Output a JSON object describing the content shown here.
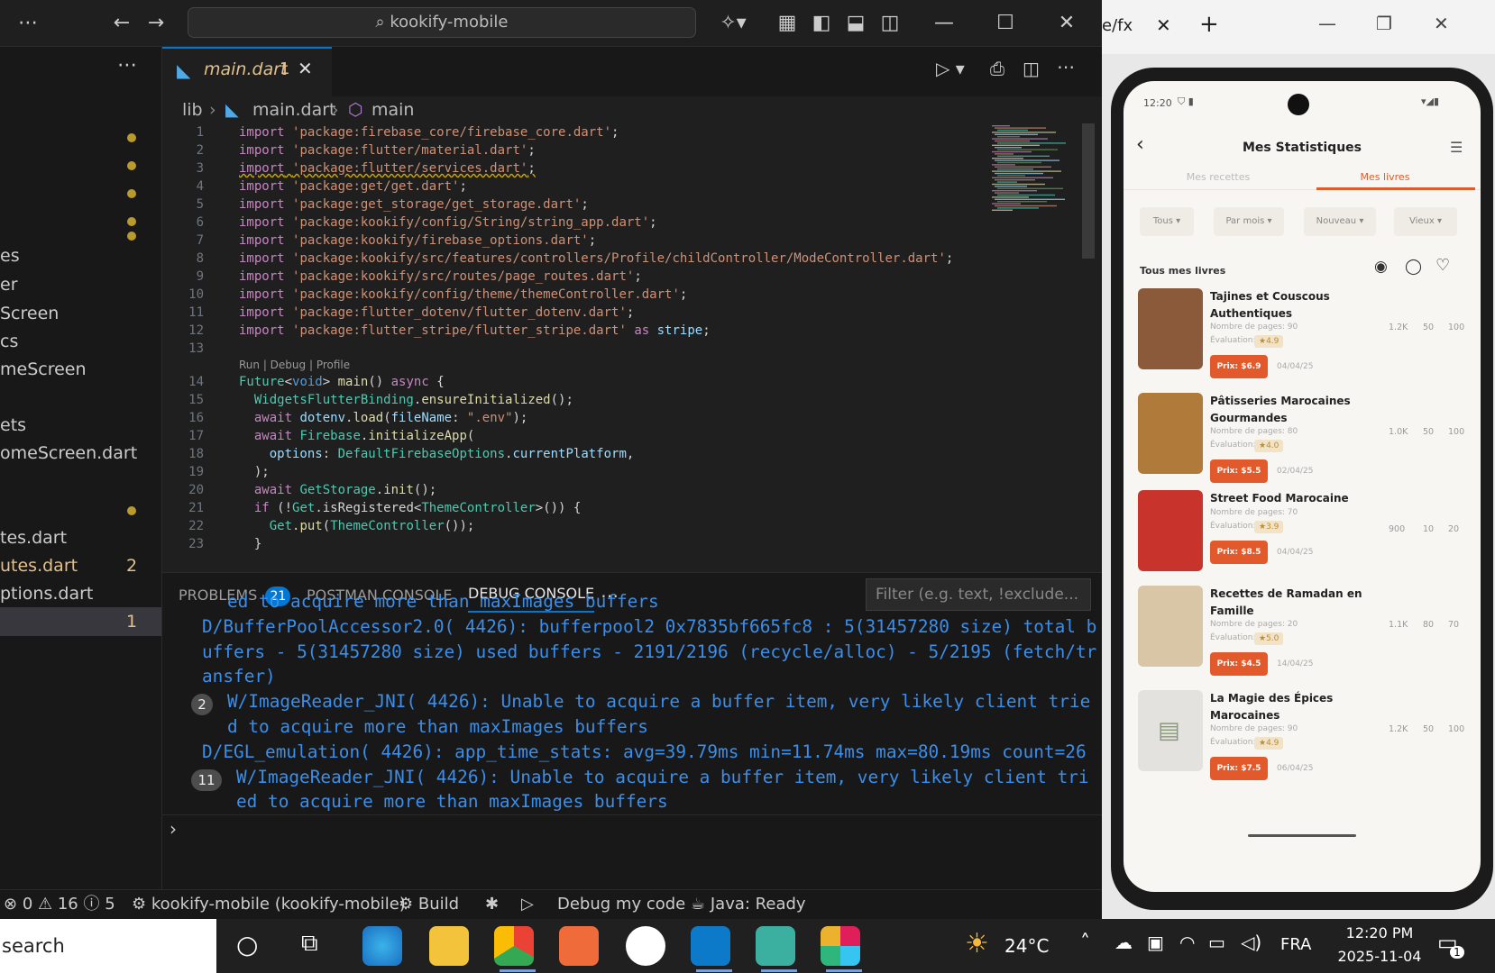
{
  "vscode": {
    "title_search": "kookify-mobile",
    "tab": {
      "name": "main.dart",
      "badge": "1"
    },
    "breadcrumb": [
      "lib",
      "main.dart",
      "main"
    ],
    "sidebar_items": [
      {
        "label": "es",
        "badge": ""
      },
      {
        "label": "er",
        "badge": ""
      },
      {
        "label": "Screen",
        "badge": ""
      },
      {
        "label": "cs",
        "badge": ""
      },
      {
        "label": "meScreen",
        "badge": ""
      },
      {
        "label": "ets",
        "badge": ""
      },
      {
        "label": "omeScreen.dart",
        "badge": ""
      },
      {
        "label": "tes.dart",
        "badge": ""
      },
      {
        "label": "utes.dart",
        "badge": "2"
      },
      {
        "label": "ptions.dart",
        "badge": ""
      },
      {
        "label": "",
        "badge": "1"
      }
    ],
    "code_lines": [
      {
        "n": "1",
        "t": "import 'package:firebase_core/firebase_core.dart';"
      },
      {
        "n": "2",
        "t": "import 'package:flutter/material.dart';"
      },
      {
        "n": "3",
        "t": "import 'package:flutter/services.dart';"
      },
      {
        "n": "4",
        "t": "import 'package:get/get.dart';"
      },
      {
        "n": "5",
        "t": "import 'package:get_storage/get_storage.dart';"
      },
      {
        "n": "6",
        "t": "import 'package:kookify/config/String/string_app.dart';"
      },
      {
        "n": "7",
        "t": "import 'package:kookify/firebase_options.dart';"
      },
      {
        "n": "8",
        "t": "import 'package:kookify/src/features/controllers/Profile/childController/ModeController.dart';"
      },
      {
        "n": "9",
        "t": "import 'package:kookify/src/routes/page_routes.dart';"
      },
      {
        "n": "10",
        "t": "import 'package:kookify/config/theme/themeController.dart';"
      },
      {
        "n": "11",
        "t": "import 'package:flutter_dotenv/flutter_dotenv.dart';"
      },
      {
        "n": "12",
        "t": "import 'package:flutter_stripe/flutter_stripe.dart' as stripe;"
      },
      {
        "n": "13",
        "t": ""
      },
      {
        "n": "",
        "t": "Run | Debug | Profile"
      },
      {
        "n": "14",
        "t": "Future<void> main() async {"
      },
      {
        "n": "15",
        "t": "  WidgetsFlutterBinding.ensureInitialized();"
      },
      {
        "n": "16",
        "t": "  await dotenv.load(fileName: \".env\");"
      },
      {
        "n": "17",
        "t": "  await Firebase.initializeApp("
      },
      {
        "n": "18",
        "t": "    options: DefaultFirebaseOptions.currentPlatform,"
      },
      {
        "n": "19",
        "t": "  );"
      },
      {
        "n": "20",
        "t": "  await GetStorage.init();"
      },
      {
        "n": "21",
        "t": "  if (!Get.isRegistered<ThemeController>()) {"
      },
      {
        "n": "22",
        "t": "    Get.put(ThemeController());"
      },
      {
        "n": "23",
        "t": "  }"
      }
    ],
    "panel": {
      "tabs": [
        "PROBLEMS",
        "POSTMAN CONSOLE",
        "DEBUG CONSOLE"
      ],
      "problems_count": "21",
      "filter_placeholder": "Filter (e.g. text, !exclude...",
      "lines": [
        {
          "badge": "",
          "indent": true,
          "t": "ed to acquire more than maxImages buffers"
        },
        {
          "badge": "",
          "indent": false,
          "t": "D/BufferPoolAccessor2.0( 4426): bufferpool2 0x7835bf665fc8 : 5(31457280 size) total b"
        },
        {
          "badge": "",
          "indent": false,
          "t": "uffers - 5(31457280 size) used buffers - 2191/2196 (recycle/alloc) - 5/2195 (fetch/tr"
        },
        {
          "badge": "",
          "indent": false,
          "t": "ansfer)"
        },
        {
          "badge": "2",
          "indent": false,
          "t": "W/ImageReader_JNI( 4426): Unable to acquire a buffer item, very likely client trie"
        },
        {
          "badge": "",
          "indent": true,
          "t": "d to acquire more than maxImages buffers"
        },
        {
          "badge": "",
          "indent": false,
          "t": "D/EGL_emulation( 4426): app_time_stats: avg=39.79ms min=11.74ms max=80.19ms count=26"
        },
        {
          "badge": "11",
          "indent": false,
          "t": "W/ImageReader_JNI( 4426): Unable to acquire a buffer item, very likely client tri"
        },
        {
          "badge": "",
          "indent": true,
          "t": "ed to acquire more than maxImages buffers"
        }
      ]
    },
    "status": {
      "errors": "0",
      "warnings": "16",
      "infos": "5",
      "project": "kookify-mobile (kookify-mobile)",
      "build": "Build",
      "debug": "Debug my code",
      "java": "Java: Ready"
    }
  },
  "browser": {
    "tab_fragment": "e/fx"
  },
  "phone": {
    "time": "12:20",
    "title": "Mes Statistiques",
    "tabs": [
      "Mes recettes",
      "Mes livres"
    ],
    "active_tab": 1,
    "filters": [
      "Tous",
      "Par mois",
      "Nouveau",
      "Vieux"
    ],
    "section_title": "Tous mes livres",
    "books": [
      {
        "title": "Tajines et Couscous Authentiques",
        "pages": "Nombre de pages: 90",
        "rating_label": "Évaluation:",
        "rating": "★4.9",
        "price": "Prix: $6.9",
        "date": "04/04/25",
        "s1": "1.2K",
        "s2": "50",
        "s3": "100",
        "thumb": "#8a5a3a"
      },
      {
        "title": "Pâtisseries Marocaines Gourmandes",
        "pages": "Nombre de pages: 80",
        "rating_label": "Évaluation:",
        "rating": "★4.0",
        "price": "Prix: $5.5",
        "date": "02/04/25",
        "s1": "1.0K",
        "s2": "50",
        "s3": "100",
        "thumb": "#b07a3a"
      },
      {
        "title": "Street Food Marocaine",
        "pages": "Nombre de pages: 70",
        "rating_label": "Évaluation:",
        "rating": "★3.9",
        "price": "Prix: $8.5",
        "date": "04/04/25",
        "s1": "900",
        "s2": "10",
        "s3": "20",
        "thumb": "#c8342c"
      },
      {
        "title": "Recettes de Ramadan en Famille",
        "pages": "Nombre de pages: 20",
        "rating_label": "Évaluation:",
        "rating": "★5.0",
        "price": "Prix: $4.5",
        "date": "14/04/25",
        "s1": "1.1K",
        "s2": "80",
        "s3": "70",
        "thumb": "#d9c6a6"
      },
      {
        "title": "La Magie des Épices Marocaines",
        "pages": "Nombre de pages: 90",
        "rating_label": "Évaluation:",
        "rating": "★4.9",
        "price": "Prix: $7.5",
        "date": "06/04/25",
        "s1": "1.2K",
        "s2": "50",
        "s3": "100",
        "thumb": "#e4e2df"
      }
    ]
  },
  "taskbar": {
    "search": "search",
    "weather": "24°C",
    "lang": "FRA",
    "time": "12:20 PM",
    "date": "2025-11-04",
    "notif": "1"
  },
  "colors": {
    "accent": "#0078d4",
    "orange": "#e25a2b",
    "console": "#3b8eea"
  }
}
